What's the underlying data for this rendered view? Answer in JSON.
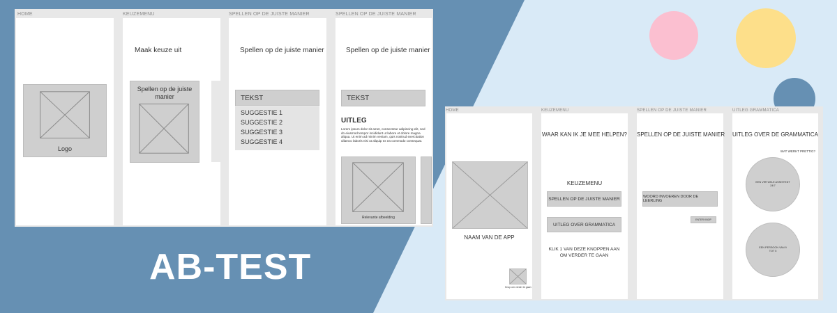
{
  "colors": {
    "background_light": "#d9eaf7",
    "background_dark": "#6690b3",
    "circle_pink": "#fbbfd0",
    "circle_yellow": "#fddf8a",
    "circle_blue": "#6690b3"
  },
  "title": "AB-TEST",
  "version_a": {
    "frame_labels": [
      "HOME",
      "KEUZEMENU",
      "SPELLEN OP DE JUISTE MANIER",
      "SPELLEN OP DE JUISTE MANIER"
    ],
    "home": {
      "logo_label": "Logo"
    },
    "keuzemenu": {
      "heading": "Maak keuze uit",
      "card_title": "Spellen op de juiste manier"
    },
    "spellen1": {
      "heading": "Spellen op de juiste manier",
      "input_label": "TEKST",
      "suggestions": [
        "SUGGESTIE 1",
        "SUGGESTIE 2",
        "SUGGESTIE 3",
        "SUGGESTIE 4"
      ]
    },
    "spellen2": {
      "heading": "Spellen op de juiste manier",
      "input_label": "TEKST",
      "uitleg_heading": "UITLEG",
      "uitleg_body": "Lorem ipsum dolor sit amet, consectetur adipiscing elit, sed do eiusmod tempor incididunt ut labore et dolore magna aliqua. Ut enim ad minim veniam, quis nostrud exercitation ullamco laboris nisi ut aliquip ex ea commodo consequat.",
      "image_caption": "Relevante afbeelding"
    }
  },
  "version_b": {
    "frame_labels": [
      "HOME",
      "KEUZEMENU",
      "SPELLEN OP DE JUISTE MANIER",
      "UITLEG GRAMMATICA"
    ],
    "home": {
      "app_name": "NAAM VAN DE APP",
      "small_caption": "Knop om verder te gaan"
    },
    "keuzemenu": {
      "question": "WAAR KAN IK JE MEE HELPEN?",
      "menu_label": "KEUZEMENU",
      "button_spellen": "SPELLEN OP DE JUISTE MANIER",
      "button_grammatica": "UITLEG OVER GRAMMATICA",
      "instruction": "KLIK 1 VAN DEZE KNOPPEN AAN OM VERDER TE GAAN"
    },
    "spellen": {
      "heading": "SPELLEN OP DE JUISTE MANIER",
      "input_button": "WOORD INVOEREN DOOR DE LEERLING",
      "submit_button": "ENTER KNOP"
    },
    "grammatica": {
      "heading": "UITLEG OVER DE GRAMMATICA",
      "question": "WAT WERKT PRETTIG?",
      "option1": "EEN VIRTUELE ASSISTENT 24/7",
      "option2": "EEN PERSOON VAN 9 TOT 5"
    }
  }
}
